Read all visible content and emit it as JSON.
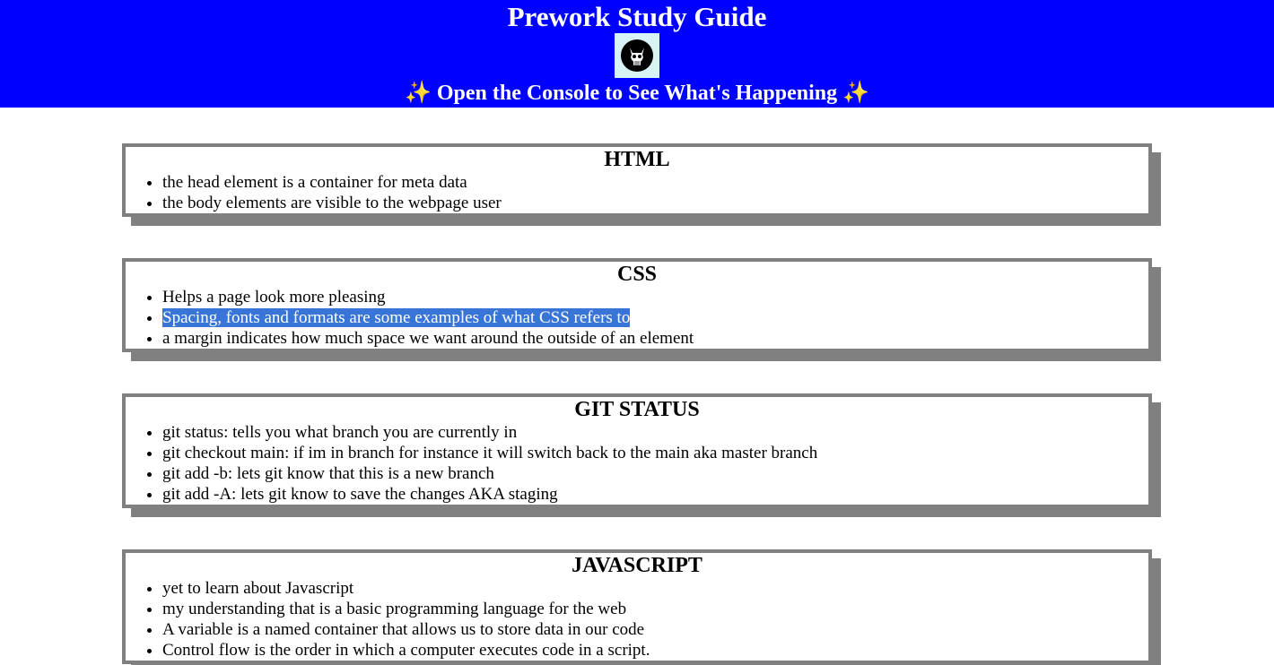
{
  "header": {
    "title": "Prework Study Guide",
    "logo_icon": "cat-skull-logo-icon",
    "subtitle_left_emoji": "✨",
    "subtitle_text": "Open the Console to See What's Happening",
    "subtitle_right_emoji": "✨",
    "background_color": "#0000ff"
  },
  "sections": [
    {
      "title": "HTML",
      "items": [
        "the head element is a container for meta data",
        "the body elements are visible to the webpage user"
      ]
    },
    {
      "title": "CSS",
      "items": [
        "Helps a page look more pleasing",
        "Spacing, fonts and formats are some examples of what CSS refers to",
        "a margin indicates how much space we want around the outside of an element"
      ],
      "selected_item_index": 1
    },
    {
      "title": "GIT STATUS",
      "items": [
        "git status: tells you what branch you are currently in",
        "git checkout main: if im in branch for instance it will switch back to the main aka master branch",
        "git add -b: lets git know that this is a new branch",
        "git add -A: lets git know to save the changes AKA staging"
      ]
    },
    {
      "title": "JAVASCRIPT",
      "items": [
        "yet to learn about Javascript",
        "my understanding that is a basic programming language for the web",
        "A variable is a named container that allows us to store data in our code",
        "Control flow is the order in which a computer executes code in a script."
      ]
    }
  ],
  "colors": {
    "card_border": "#808080",
    "selection_highlight": "#3875d7"
  }
}
